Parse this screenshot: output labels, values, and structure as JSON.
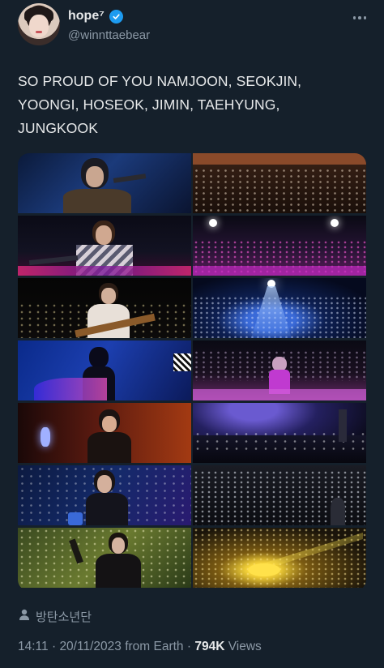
{
  "author": {
    "display_name": "hope⁷",
    "handle": "@winnttaebear",
    "verified": true,
    "verified_color": "#1d9bf0"
  },
  "tweet": {
    "text": "SO PROUD OF YOU NAMJOON, SEOKJIN, YOONGI, HOSEOK, JIMIN, TAEHYUNG, JUNGKOOK"
  },
  "media": {
    "tile_count": 14,
    "icons": [
      "more-icon",
      "verified-icon",
      "location-icon"
    ]
  },
  "footer": {
    "place": "방탄소년단",
    "time": "14:11",
    "date": "20/11/2023",
    "source": "from Earth",
    "views_count": "794K",
    "views_label": "Views",
    "separator": "·"
  },
  "theme": {
    "background": "#15202b",
    "text": "#e7e9ea",
    "secondary_text": "#8b98a5"
  }
}
